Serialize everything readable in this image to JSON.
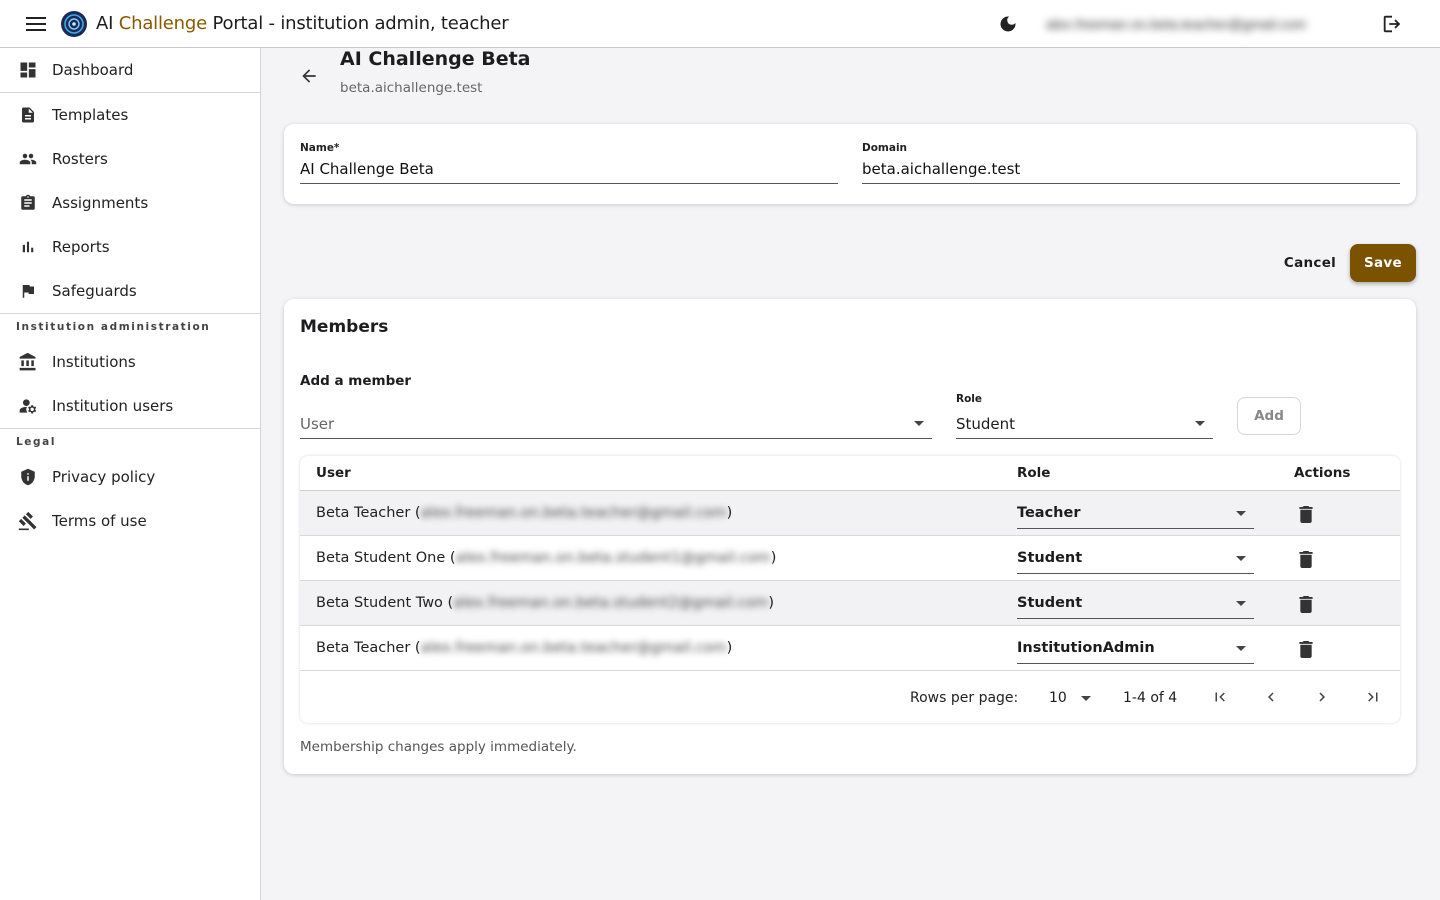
{
  "header": {
    "title_prefix": "AI",
    "title_accent": "Challenge",
    "title_rest": "Portal - institution admin, teacher",
    "user_email": "alex.freeman.on.beta.teacher@gmail.com",
    "icons": {
      "menu": "menu-icon",
      "logo": "logo-icon",
      "theme": "dark-mode-icon",
      "logout": "logout-icon"
    }
  },
  "sidebar": {
    "items": [
      {
        "label": "Dashboard",
        "icon": "dashboard-icon"
      },
      {
        "label": "Templates",
        "icon": "document-icon"
      },
      {
        "label": "Rosters",
        "icon": "people-icon"
      },
      {
        "label": "Assignments",
        "icon": "clipboard-icon"
      },
      {
        "label": "Reports",
        "icon": "bar-chart-icon"
      },
      {
        "label": "Safeguards",
        "icon": "flag-icon"
      }
    ],
    "section_admin": "Institution administration",
    "admin_items": [
      {
        "label": "Institutions",
        "icon": "bank-icon"
      },
      {
        "label": "Institution users",
        "icon": "user-settings-icon"
      }
    ],
    "section_legal": "Legal",
    "legal_items": [
      {
        "label": "Privacy policy",
        "icon": "shield-icon"
      },
      {
        "label": "Terms of use",
        "icon": "gavel-icon"
      }
    ]
  },
  "page": {
    "title": "AI Challenge Beta",
    "subtitle": "beta.aichallenge.test"
  },
  "form": {
    "name_label": "Name*",
    "name_value": "AI Challenge Beta",
    "domain_label": "Domain",
    "domain_value": "beta.aichallenge.test"
  },
  "actions": {
    "cancel": "Cancel",
    "save": "Save"
  },
  "members": {
    "title": "Members",
    "add_title": "Add a member",
    "user_placeholder": "User",
    "role_label": "Role",
    "role_value": "Student",
    "add_button": "Add",
    "columns": {
      "user": "User",
      "role": "Role",
      "actions": "Actions"
    },
    "rows": [
      {
        "name": "Beta Teacher",
        "email": "alex.freeman.on.beta.teacher@gmail.com",
        "role": "Teacher"
      },
      {
        "name": "Beta Student One",
        "email": "alex.freeman.on.beta.student1@gmail.com",
        "role": "Student"
      },
      {
        "name": "Beta Student Two",
        "email": "alex.freeman.on.beta.student2@gmail.com",
        "role": "Student"
      },
      {
        "name": "Beta Teacher",
        "email": "alex.freeman.on.beta.teacher@gmail.com",
        "role": "InstitutionAdmin"
      }
    ],
    "pager": {
      "rows_per_page_label": "Rows per page:",
      "rows_per_page": "10",
      "range": "1-4 of 4"
    },
    "footnote": "Membership changes apply immediately."
  },
  "colors": {
    "accent": "#8a5a00",
    "save_button": "#7a5200"
  }
}
